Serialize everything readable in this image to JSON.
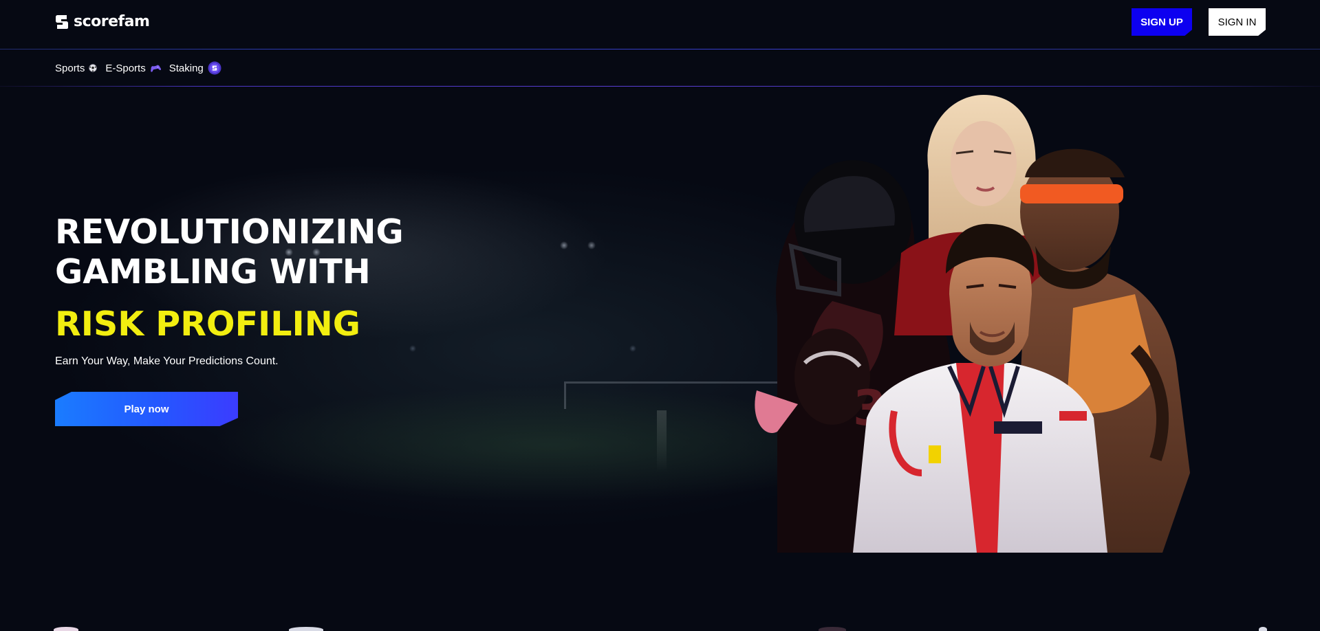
{
  "header": {
    "brand": "scorefam",
    "logo_icon": "scorefam-logo-icon",
    "signup_label": "SIGN UP",
    "signin_label": "SIGN IN",
    "signup_color": "#0d00f0",
    "signin_color": "#ffffff"
  },
  "nav": {
    "items": [
      {
        "label": "Sports",
        "icon": "soccer-ball-icon"
      },
      {
        "label": "E-Sports",
        "icon": "gamepad-icon"
      },
      {
        "label": "Staking",
        "icon": "staking-coin-icon"
      }
    ]
  },
  "hero": {
    "title": "REVOLUTIONIZING GAMBLING WITH",
    "highlight": "RISK PROFILING",
    "subtitle": "Earn Your Way, Make Your Predictions Count.",
    "cta_label": "Play now",
    "highlight_color": "#f2ee10",
    "cta_gradient": [
      "#1a7cff",
      "#3b3cff"
    ]
  },
  "colors": {
    "background": "#060913",
    "accent": "#4a36c4"
  }
}
